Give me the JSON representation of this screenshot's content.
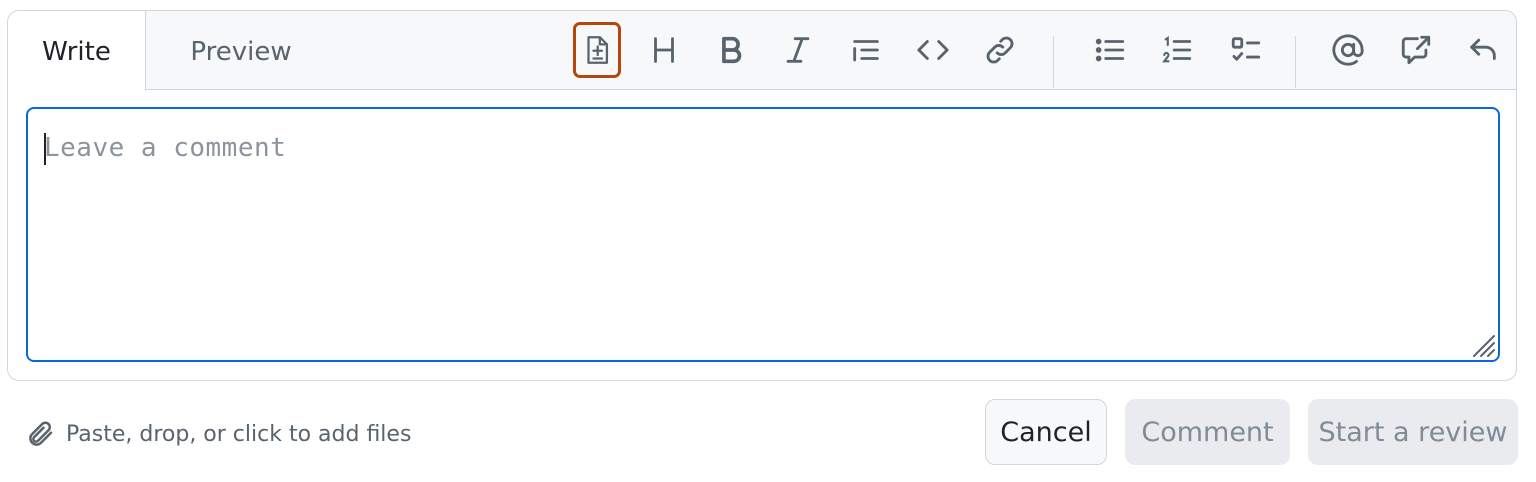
{
  "tabs": {
    "write": "Write",
    "preview": "Preview"
  },
  "toolbar": {
    "items": [
      "diff-icon",
      "heading-icon",
      "bold-icon",
      "italic-icon",
      "quote-icon",
      "code-icon",
      "link-icon",
      "unordered-list-icon",
      "ordered-list-icon",
      "tasklist-icon",
      "mention-icon",
      "cross-reference-icon",
      "undo-icon"
    ],
    "highlight_color": "#b5470e",
    "icon_color": "#59636e"
  },
  "comment": {
    "placeholder": "Leave a comment",
    "value": ""
  },
  "attach": {
    "label": "Paste, drop, or click to add files"
  },
  "buttons": {
    "cancel": "Cancel",
    "comment": "Comment",
    "start_review": "Start a review"
  },
  "colors": {
    "focus_border": "#0969da",
    "border": "#d0d7de",
    "tabbar_bg": "#f6f8fa"
  }
}
